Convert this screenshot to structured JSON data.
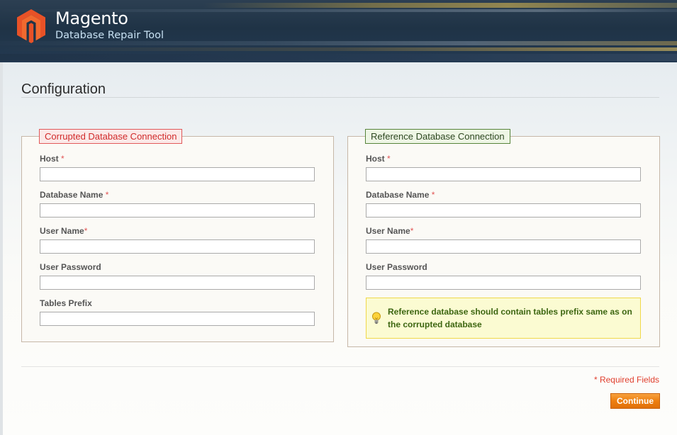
{
  "header": {
    "brand_name": "Magento",
    "brand_subtitle": "Database Repair Tool",
    "logo_icon": "magento-logo-icon",
    "logo_color": "#e34f24"
  },
  "page": {
    "title": "Configuration"
  },
  "corrupted": {
    "legend": "Corrupted Database Connection",
    "accent_color": "#d12b2b",
    "fields": [
      {
        "label": "Host",
        "required_mark": "*",
        "value": ""
      },
      {
        "label": "Database Name",
        "required_mark": "*",
        "value": ""
      },
      {
        "label": "User Name",
        "required_mark": "*",
        "value": ""
      },
      {
        "label": "User Password",
        "required_mark": "",
        "value": ""
      },
      {
        "label": "Tables Prefix",
        "required_mark": "",
        "value": ""
      }
    ]
  },
  "reference": {
    "legend": "Reference Database Connection",
    "accent_color": "#57843a",
    "fields": [
      {
        "label": "Host",
        "required_mark": "*",
        "value": ""
      },
      {
        "label": "Database Name",
        "required_mark": "*",
        "value": ""
      },
      {
        "label": "User Name",
        "required_mark": "*",
        "value": ""
      },
      {
        "label": "User Password",
        "required_mark": "",
        "value": ""
      }
    ],
    "notice": {
      "icon": "lightbulb-icon",
      "text": "Reference database should contain tables prefix same as on the corrupted database"
    }
  },
  "footer": {
    "required_note": "* Required Fields",
    "continue_label": "Continue",
    "continue_color": "#ee7f10"
  }
}
